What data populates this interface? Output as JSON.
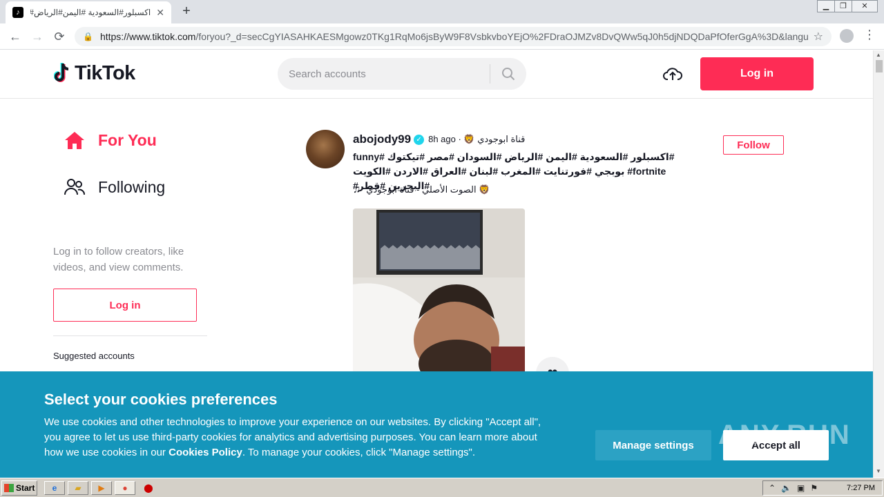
{
  "browser": {
    "tab_title": "اكسبلور#السعودية #اليمن#الرياض#",
    "favicon": "tiktok-icon",
    "url_host": "https://www.tiktok.com",
    "url_path": "/foryou?_d=secCgYIASAHKAESMgowz0TKg1RqMo6jsByW9F8VsbkvboYEjO%2FDraOJMZv8DvQWw5qJ0h5djNDQDaPfOferGgA%3D&langua..."
  },
  "header": {
    "logo_text": "TikTok",
    "search_placeholder": "Search accounts",
    "login_label": "Log in"
  },
  "sidebar": {
    "nav": [
      {
        "label": "For You",
        "icon": "home-icon"
      },
      {
        "label": "Following",
        "icon": "users-icon"
      }
    ],
    "prompt": "Log in to follow creators, like videos, and view comments.",
    "login_label": "Log in",
    "suggested_label": "Suggested accounts"
  },
  "post": {
    "username": "abojody99",
    "meta": "قناة ابوجودي 🦁 · 8h ago",
    "caption": "#اكسبلور #السعودية #اليمن #الرياض #السودان #مصر #تيكتوك #funny #fortnite بوبجي #فورتنايت #المغرب #لبنان #العراق #الاردن #الكويت #البحرين #قطر#",
    "music": "الصوت الأصلي - قناة ابوجودي 🦁",
    "follow_label": "Follow"
  },
  "cookies": {
    "title": "Select your cookies preferences",
    "body_part1": "We use cookies and other technologies to improve your experience on our websites. By clicking \"Accept all\", you agree to let us use third-party cookies for analytics and advertising purposes. You can learn more about how we use cookies in our ",
    "policy_link": "Cookies Policy",
    "body_part2": ". To manage your cookies, click \"Manage settings\".",
    "manage_label": "Manage settings",
    "accept_label": "Accept all"
  },
  "watermark": "ANY.RUN",
  "taskbar": {
    "start_label": "Start",
    "clock": "7:27 PM"
  },
  "colors": {
    "brand": "#fe2c55",
    "cookie_banner": "#1596bb"
  }
}
